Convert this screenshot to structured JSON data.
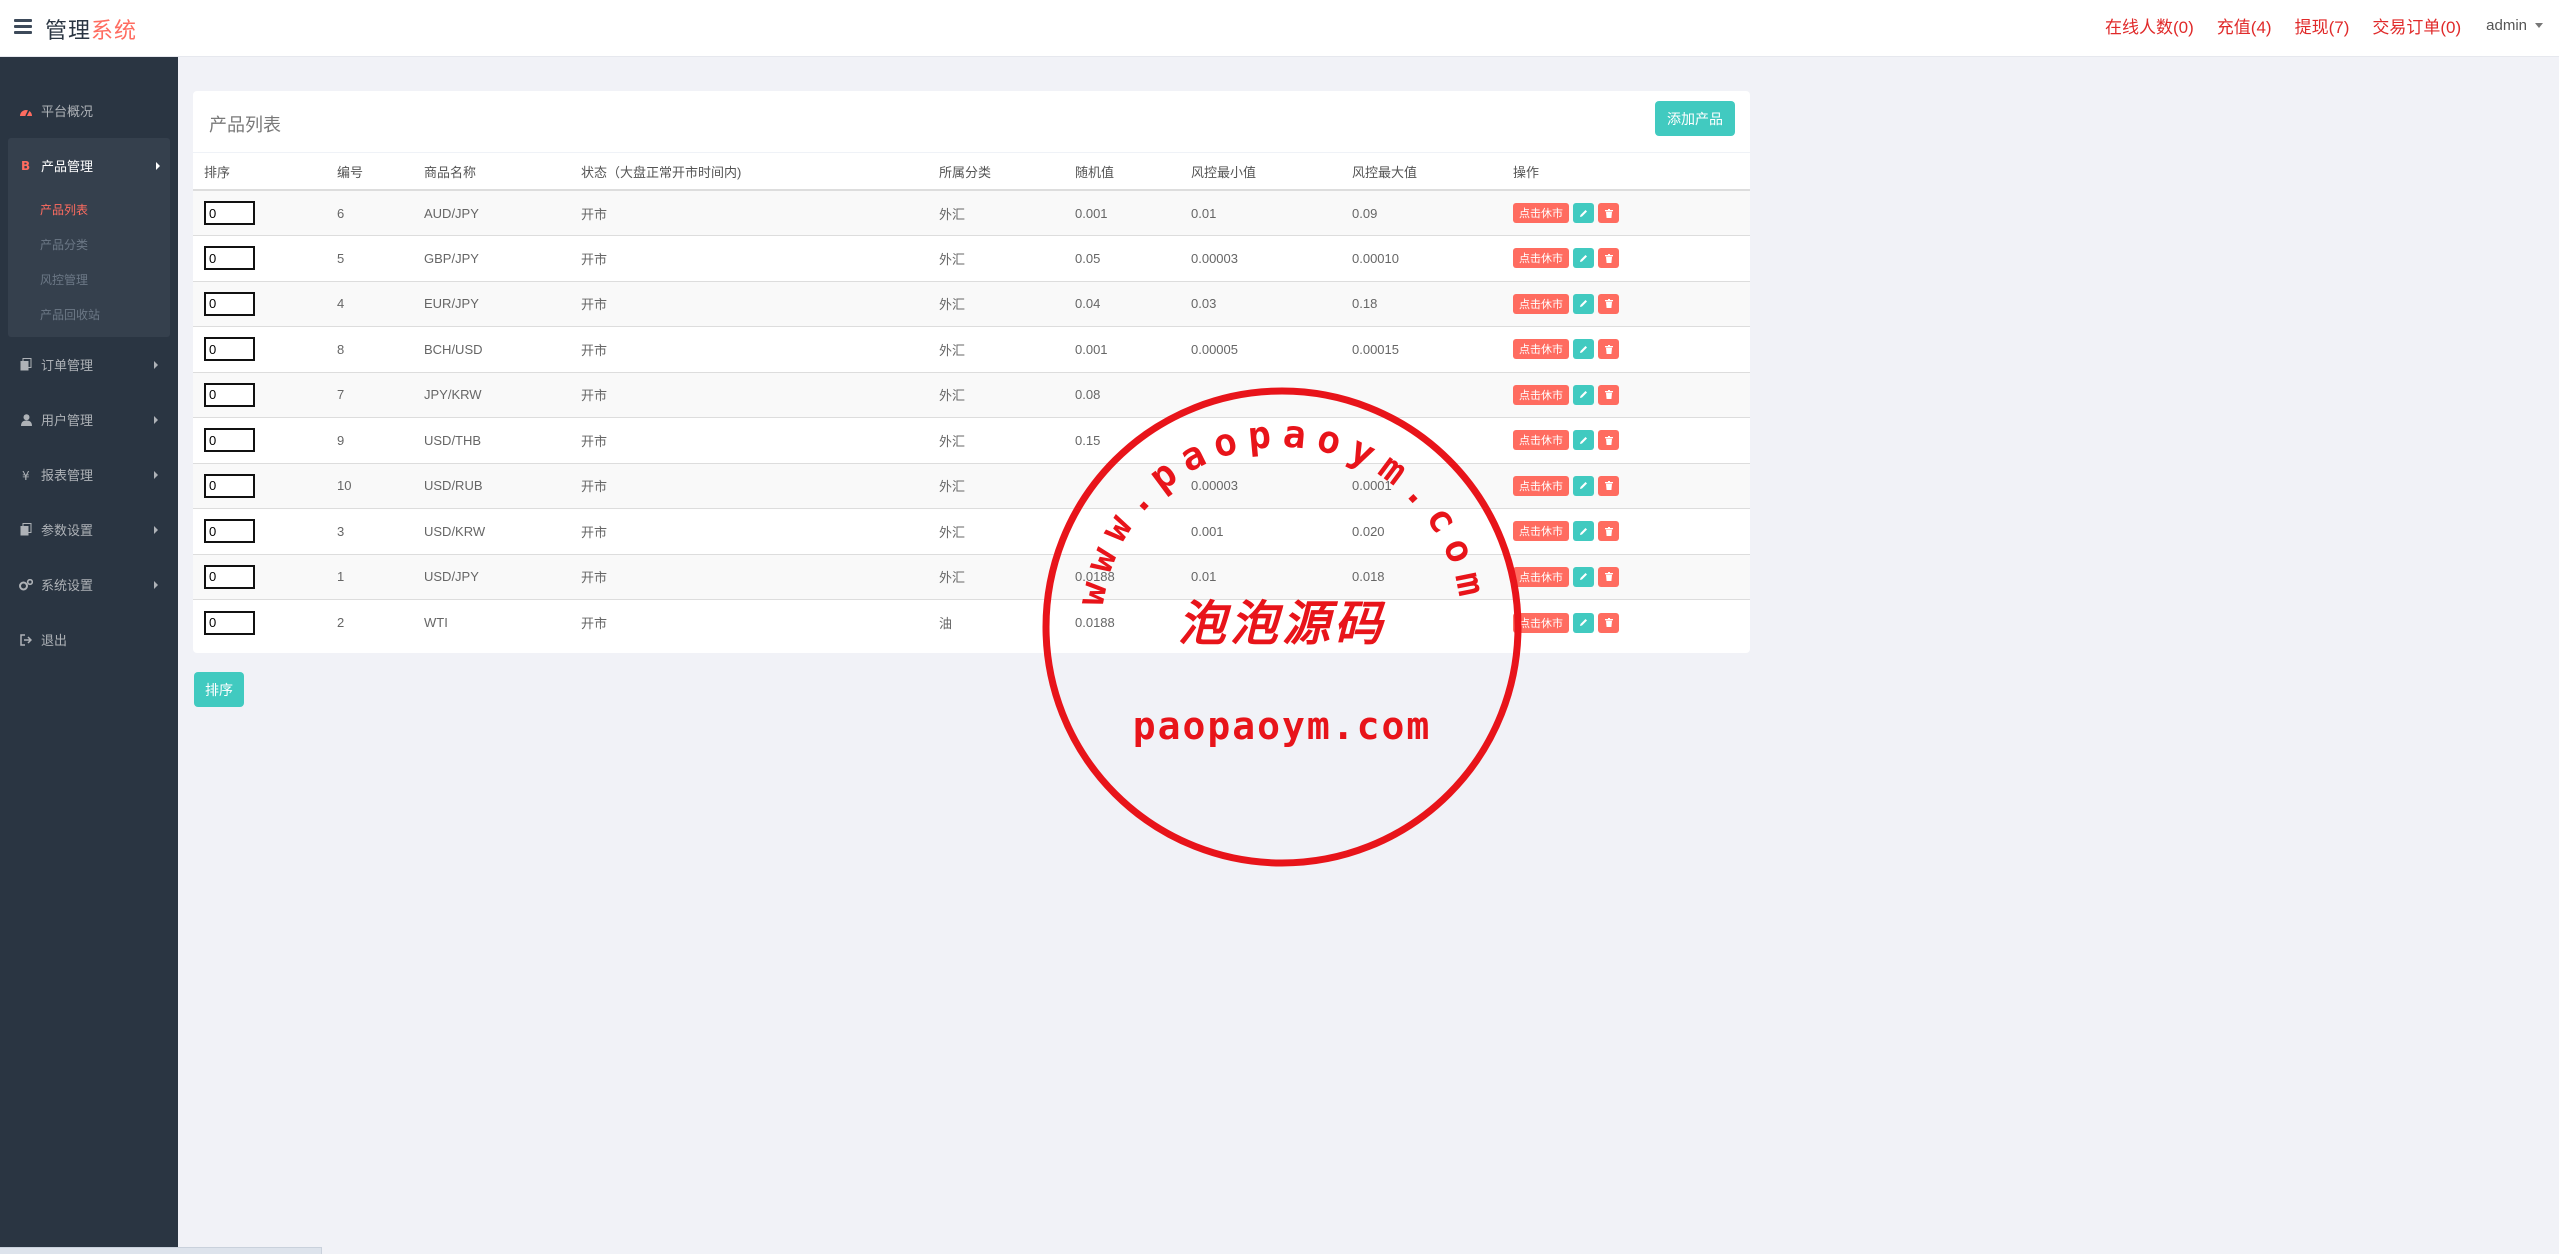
{
  "header": {
    "brand_main": "管理",
    "brand_accent": "系统",
    "nav": {
      "online": "在线人数(0)",
      "recharge": "充值(4)",
      "withdraw": "提现(7)",
      "orders": "交易订单(0)"
    },
    "user": "admin"
  },
  "sidebar": {
    "dashboard": "平台概况",
    "products": {
      "label": "产品管理",
      "sub": [
        "产品列表",
        "产品分类",
        "风控管理",
        "产品回收站"
      ]
    },
    "orders": "订单管理",
    "users": "用户管理",
    "reports": "报表管理",
    "params": "参数设置",
    "system": "系统设置",
    "logout": "退出"
  },
  "panel": {
    "title": "产品列表",
    "add_button": "添加产品",
    "columns": [
      "排序",
      "编号",
      "商品名称",
      "状态（大盘正常开市时间内)",
      "所属分类",
      "随机值",
      "风控最小值",
      "风控最大值",
      "操作"
    ],
    "rows": [
      {
        "sort": "0",
        "id": "6",
        "name": "AUD/JPY",
        "status": "开市",
        "category": "外汇",
        "random": "0.001",
        "min": "0.01",
        "max": "0.09"
      },
      {
        "sort": "0",
        "id": "5",
        "name": "GBP/JPY",
        "status": "开市",
        "category": "外汇",
        "random": "0.05",
        "min": "0.00003",
        "max": "0.00010"
      },
      {
        "sort": "0",
        "id": "4",
        "name": "EUR/JPY",
        "status": "开市",
        "category": "外汇",
        "random": "0.04",
        "min": "0.03",
        "max": "0.18"
      },
      {
        "sort": "0",
        "id": "8",
        "name": "BCH/USD",
        "status": "开市",
        "category": "外汇",
        "random": "0.001",
        "min": "0.00005",
        "max": "0.00015"
      },
      {
        "sort": "0",
        "id": "7",
        "name": "JPY/KRW",
        "status": "开市",
        "category": "外汇",
        "random": "0.08",
        "min": "",
        "max": ""
      },
      {
        "sort": "0",
        "id": "9",
        "name": "USD/THB",
        "status": "开市",
        "category": "外汇",
        "random": "0.15",
        "min": "",
        "max": ""
      },
      {
        "sort": "0",
        "id": "10",
        "name": "USD/RUB",
        "status": "开市",
        "category": "外汇",
        "random": "",
        "min": "0.00003",
        "max": "0.0001"
      },
      {
        "sort": "0",
        "id": "3",
        "name": "USD/KRW",
        "status": "开市",
        "category": "外汇",
        "random": "",
        "min": "0.001",
        "max": "0.020"
      },
      {
        "sort": "0",
        "id": "1",
        "name": "USD/JPY",
        "status": "开市",
        "category": "外汇",
        "random": "0.0188",
        "min": "0.01",
        "max": "0.018"
      },
      {
        "sort": "0",
        "id": "2",
        "name": "WTI",
        "status": "开市",
        "category": "油",
        "random": "0.0188",
        "min": "",
        "max": ""
      }
    ],
    "row_status_button": "点击休市"
  },
  "sort_button": "排序",
  "stamp": {
    "url_text": "www.paopaoym.com",
    "chinese": "泡泡源码",
    "domain": "paopaoym.com"
  },
  "colors": {
    "sidebar_bg": "#2a3542",
    "accent_red": "#ff6c60",
    "accent_teal": "#41cac0",
    "stamp_red": "#e8141a"
  }
}
